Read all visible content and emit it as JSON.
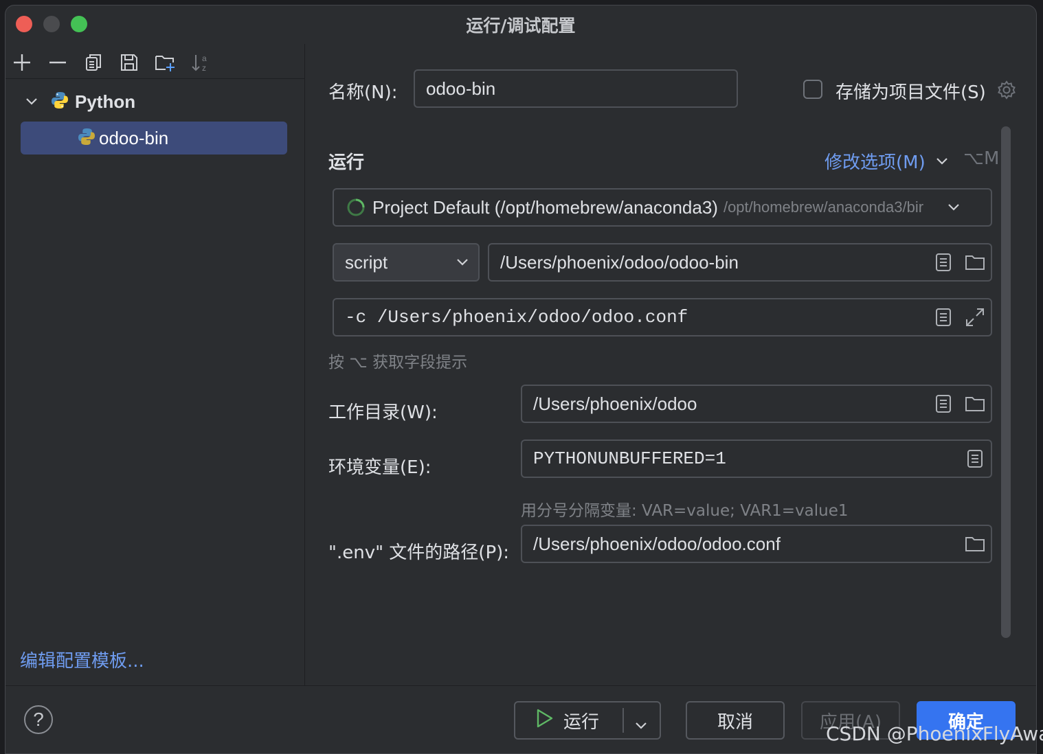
{
  "window": {
    "title": "运行/调试配置"
  },
  "toolbar": {
    "icons": [
      "add-icon",
      "remove-icon",
      "copy-icon",
      "save-icon",
      "new-folder-icon",
      "sort-alpha-icon"
    ]
  },
  "tree": {
    "group_label": "Python",
    "item_label": "odoo-bin"
  },
  "left": {
    "edit_templates": "编辑配置模板..."
  },
  "form": {
    "name_label": "名称(N):",
    "name_value": "odoo-bin",
    "store_as_file_label": "存储为项目文件(S)",
    "store_as_file_checked": false,
    "run_section_label": "运行",
    "modify_options_label": "修改选项(M)",
    "modify_options_shortcut": "⌥M",
    "interpreter_main": "Project Default (/opt/homebrew/anaconda3)",
    "interpreter_path": "/opt/homebrew/anaconda3/bir",
    "script_type": "script",
    "script_path": "/Users/phoenix/odoo/odoo-bin",
    "script_params": "-c /Users/phoenix/odoo/odoo.conf",
    "field_hint": "按 ⌥ 获取字段提示",
    "workdir_label": "工作目录(W):",
    "workdir_value": "/Users/phoenix/odoo",
    "env_label": "环境变量(E):",
    "env_value": "PYTHONUNBUFFERED=1",
    "env_hint": "用分号分隔变量: VAR=value; VAR1=value1",
    "dotenv_label": "\".env\" 文件的路径(P):",
    "dotenv_value": "/Users/phoenix/odoo/odoo.conf"
  },
  "buttons": {
    "help": "?",
    "run": "运行",
    "cancel": "取消",
    "apply": "应用(A)",
    "ok": "确定"
  },
  "watermark": "CSDN @PhoenixFlyAway",
  "colors": {
    "accent": "#3574f0",
    "link": "#6f9cf0",
    "selection": "#3d4b7a",
    "background": "#2b2d30"
  }
}
